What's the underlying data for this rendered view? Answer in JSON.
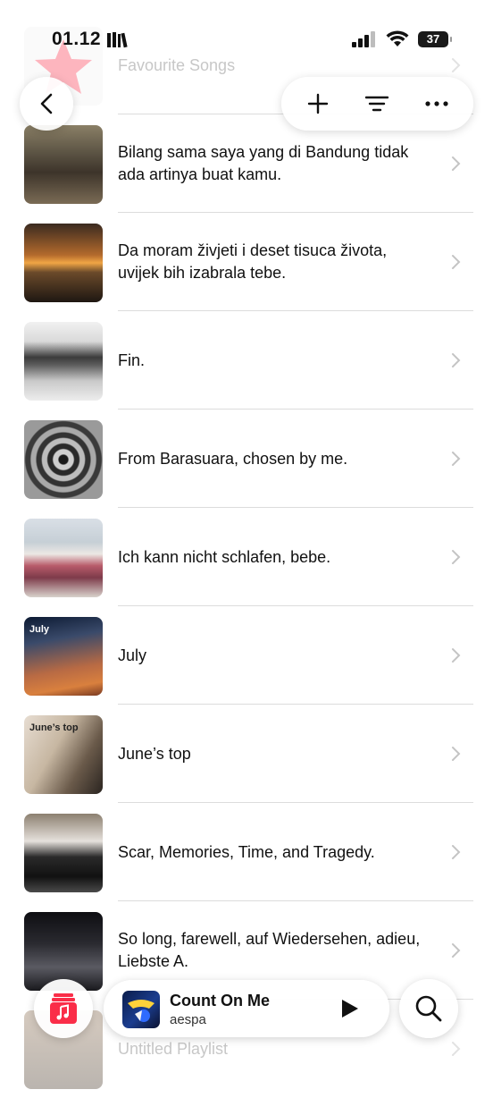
{
  "status_bar": {
    "time": "01.12",
    "battery": "37"
  },
  "nav": {
    "back_icon": "chevron-left-icon",
    "actions": [
      "plus-icon",
      "sort-lines-icon",
      "more-ellipsis-icon"
    ]
  },
  "playlists": [
    {
      "title": "Favourite Songs",
      "faded": true,
      "thumb_label": ""
    },
    {
      "title": "Bilang sama saya yang di Bandung tidak ada artinya buat kamu.",
      "thumb_label": ""
    },
    {
      "title": "Da moram živjeti i deset tisuca života, uvijek bih izabrala tebe.",
      "thumb_label": ""
    },
    {
      "title": "Fin.",
      "thumb_label": ""
    },
    {
      "title": "From Barasuara, chosen by me.",
      "thumb_label": ""
    },
    {
      "title": "Ich kann nicht schlafen, bebe.",
      "thumb_label": ""
    },
    {
      "title": "July",
      "thumb_label": "July"
    },
    {
      "title": "June’s top",
      "thumb_label": "June’s top"
    },
    {
      "title": "Scar, Memories, Time, and Tragedy.",
      "thumb_label": ""
    },
    {
      "title": "So long, farewell, auf Wiedersehen, adieu, Liebste A.",
      "thumb_label": ""
    },
    {
      "title": "Untitled Playlist",
      "faded": true,
      "thumb_label": ""
    }
  ],
  "mini_player": {
    "song": "Count On Me",
    "artist": "aespa",
    "play_icon": "play-icon"
  },
  "colors": {
    "accent": "#fa2d48",
    "divider": "#dcdcdc",
    "chevron": "#c4c4c4"
  }
}
